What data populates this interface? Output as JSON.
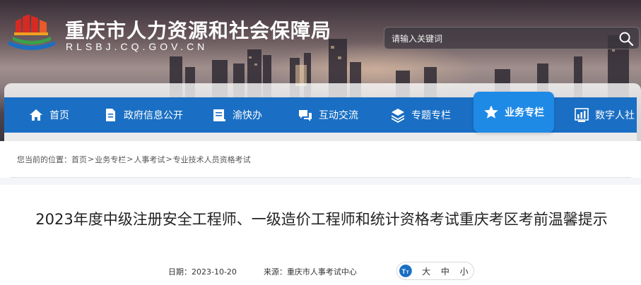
{
  "header": {
    "site_title": "重庆市人力资源和社会保障局",
    "site_domain": "RLSBJ.CQ.GOV.CN",
    "search_placeholder": "请输入关键词"
  },
  "nav": {
    "items": [
      {
        "label": "首页",
        "icon": "home-icon"
      },
      {
        "label": "政府信息公开",
        "icon": "document-icon"
      },
      {
        "label": "渝快办",
        "icon": "book-icon"
      },
      {
        "label": "互动交流",
        "icon": "chat-icon"
      },
      {
        "label": "专题专栏",
        "icon": "layers-icon"
      },
      {
        "label": "业务专栏",
        "icon": "star-icon",
        "active": true
      },
      {
        "label": "数字人社",
        "icon": "chart-icon"
      }
    ]
  },
  "breadcrumb": {
    "prefix": "您当前的位置：",
    "items": [
      "首页",
      "业务专栏",
      "人事考试",
      "专业技术人员资格考试"
    ],
    "separator": ">"
  },
  "article": {
    "title": "2023年度中级注册安全工程师、一级造价工程师和统计资格考试重庆考区考前温馨提示",
    "date_label": "日期：",
    "date": "2023-10-20",
    "source_label": "来源：",
    "source": "重庆市人事考试中心",
    "font_sizes": [
      "大",
      "中",
      "小"
    ]
  },
  "colors": {
    "nav_bg": "#1a6fc4",
    "nav_active": "#1f8ae6"
  }
}
